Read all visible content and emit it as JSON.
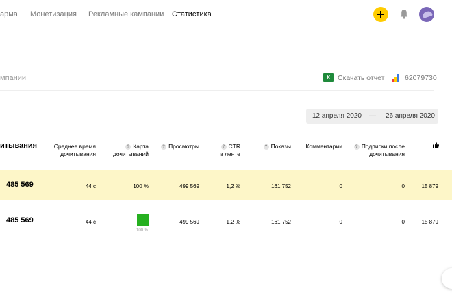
{
  "nav": {
    "items": [
      "арма",
      "Монетизация",
      "Рекламные кампании",
      "Статистика"
    ],
    "active_index": 3
  },
  "header": {
    "title": "мпании",
    "export_label": "Скачать отчет",
    "counter_id": "62079730"
  },
  "date_range": {
    "from": "12 апреля 2020",
    "separator": "—",
    "to": "26 апреля 2020"
  },
  "table": {
    "columns": [
      {
        "label": "итывания",
        "help": false
      },
      {
        "label": "Среднее время\nдочитывания",
        "help": false
      },
      {
        "label": "Карта\nдочитываний",
        "help": true
      },
      {
        "label": "Просмотры",
        "help": true
      },
      {
        "label": "CTR\nв ленте",
        "help": true
      },
      {
        "label": "Показы",
        "help": true
      },
      {
        "label": "Комментарии",
        "help": false
      },
      {
        "label": "Подписки после\nдочитывания",
        "help": true
      },
      {
        "label": "",
        "icon": "thumbs-up-icon"
      }
    ],
    "help_glyph": "?",
    "rows": [
      {
        "main": "485 569",
        "avg_time": "44 с",
        "map": "100 %",
        "views": "499 569",
        "ctr": "1,2 %",
        "impressions": "161 752",
        "comments": "0",
        "subscriptions": "0",
        "likes": "15 879",
        "highlighted": true
      },
      {
        "main": "485 569",
        "avg_time": "44 с",
        "map": "100 %",
        "map_level": 1.0,
        "views": "499 569",
        "ctr": "1,2 %",
        "impressions": "161 752",
        "comments": "0",
        "subscriptions": "0",
        "likes": "15 879",
        "highlighted": false
      }
    ]
  },
  "colors": {
    "accent": "#ffcc00",
    "highlight_row": "#fdf6c8",
    "heatmap_fill": "#26b020",
    "excel_icon": "#1f8a3b"
  },
  "icons": [
    "plus-icon",
    "bell-icon",
    "avatar",
    "excel-icon",
    "stats-bar-icon",
    "help-icon",
    "thumbs-up-icon"
  ]
}
